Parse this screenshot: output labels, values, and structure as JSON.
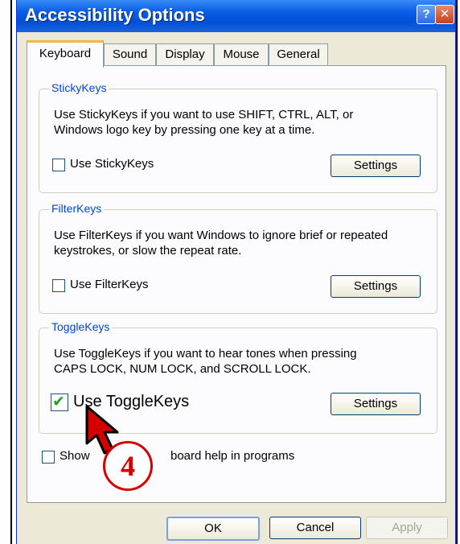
{
  "window": {
    "title": "Accessibility Options",
    "help_label": "?",
    "close_label": "✕"
  },
  "tabs": [
    {
      "label": "Keyboard",
      "selected": true
    },
    {
      "label": "Sound",
      "selected": false
    },
    {
      "label": "Display",
      "selected": false
    },
    {
      "label": "Mouse",
      "selected": false
    },
    {
      "label": "General",
      "selected": false
    }
  ],
  "sticky": {
    "title": "StickyKeys",
    "description_line1": "Use StickyKeys if you want to use SHIFT, CTRL, ALT, or",
    "description_line2": "Windows logo key by pressing one key at a time.",
    "checkbox_label": "Use StickyKeys",
    "checked": false,
    "settings_label": "Settings"
  },
  "filter": {
    "title": "FilterKeys",
    "description_line1": "Use FilterKeys if you want Windows to ignore brief or repeated",
    "description_line2": "keystrokes, or slow the repeat rate.",
    "checkbox_label": "Use FilterKeys",
    "checked": false,
    "settings_label": "Settings"
  },
  "toggle": {
    "title": "ToggleKeys",
    "description_line1": "Use ToggleKeys if you want to hear tones when pressing",
    "description_line2": "CAPS LOCK, NUM LOCK, and SCROLL LOCK.",
    "checkbox_label": "Use ToggleKeys",
    "checked": true,
    "checkmark": "✔",
    "settings_label": "Settings"
  },
  "help_option": {
    "label_start": "Show",
    "label_end": "board help in programs",
    "checked": false
  },
  "annotation": {
    "step_number": "4"
  },
  "buttons": {
    "ok": "OK",
    "cancel": "Cancel",
    "apply": "Apply"
  },
  "colors": {
    "titlebar": "#0a5fe6",
    "group_title": "#0046d5",
    "annotation": "#d40000",
    "check": "#21a121"
  }
}
